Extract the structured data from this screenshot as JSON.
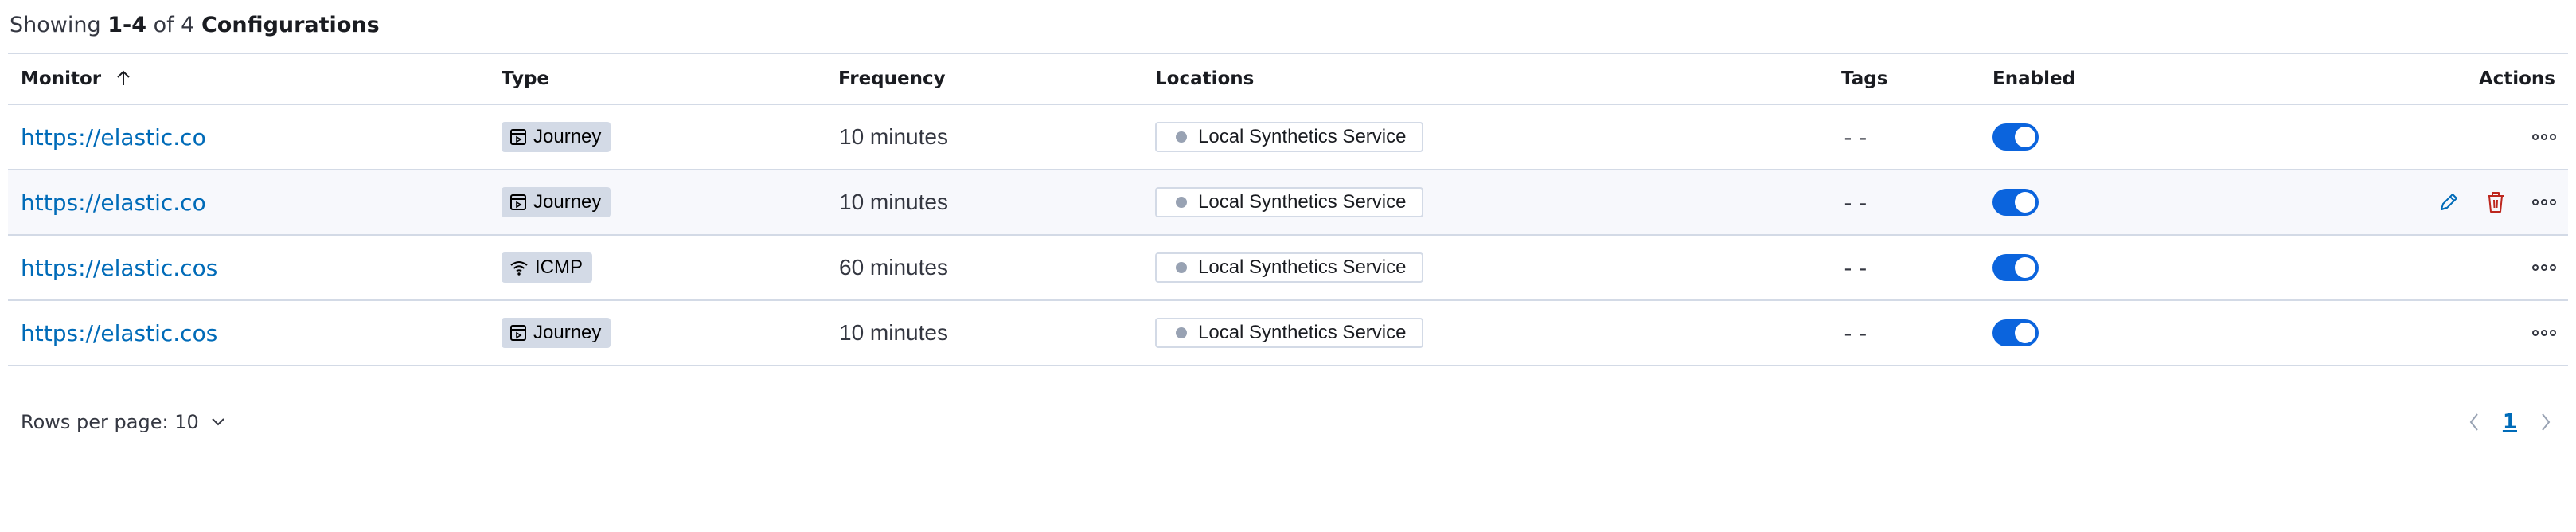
{
  "summary": {
    "prefix": "Showing",
    "range": "1-4",
    "of": "of 4",
    "noun": "Configurations"
  },
  "columns": {
    "monitor": "Monitor",
    "type": "Type",
    "frequency": "Frequency",
    "locations": "Locations",
    "tags": "Tags",
    "enabled": "Enabled",
    "actions": "Actions"
  },
  "rows": [
    {
      "monitor": "https://elastic.co",
      "type": "Journey",
      "type_icon": "journey-icon",
      "frequency": "10 minutes",
      "location": "Local Synthetics Service",
      "tags": "--",
      "enabled": true,
      "hovered": false
    },
    {
      "monitor": "https://elastic.co",
      "type": "Journey",
      "type_icon": "journey-icon",
      "frequency": "10 minutes",
      "location": "Local Synthetics Service",
      "tags": "--",
      "enabled": true,
      "hovered": true
    },
    {
      "monitor": "https://elastic.cos",
      "type": "ICMP",
      "type_icon": "wifi-icon",
      "frequency": "60 minutes",
      "location": "Local Synthetics Service",
      "tags": "--",
      "enabled": true,
      "hovered": false
    },
    {
      "monitor": "https://elastic.cos",
      "type": "Journey",
      "type_icon": "journey-icon",
      "frequency": "10 minutes",
      "location": "Local Synthetics Service",
      "tags": "--",
      "enabled": true,
      "hovered": false
    }
  ],
  "pagination": {
    "rows_per_page_label": "Rows per page: 10",
    "current_page": "1"
  },
  "colors": {
    "link": "#006bb8",
    "toggle_on": "#0b64dd",
    "delete": "#bd271e",
    "badge_bg": "#d3dae6"
  }
}
